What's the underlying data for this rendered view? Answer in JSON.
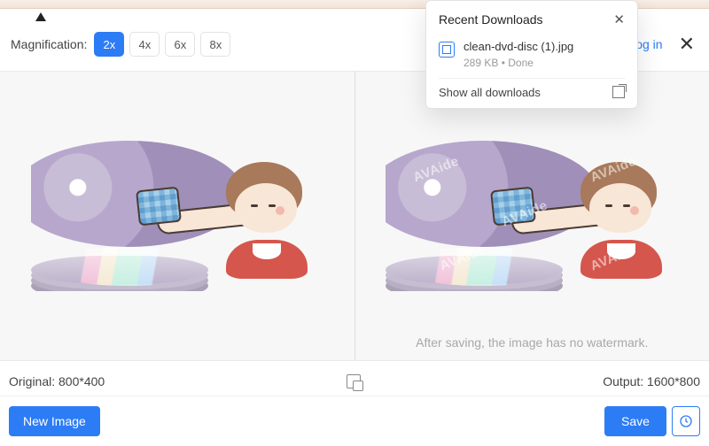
{
  "toolbar": {
    "magnification_label": "Magnification:",
    "options": [
      "2x",
      "4x",
      "6x",
      "8x"
    ],
    "active_index": 0,
    "login_label": "og in"
  },
  "downloads": {
    "title": "Recent Downloads",
    "item_filename": "clean-dvd-disc (1).jpg",
    "item_meta": "289 KB • Done",
    "show_all_label": "Show all downloads"
  },
  "preview": {
    "watermark_text": "AVAide",
    "hint_text": "After saving, the image has no watermark."
  },
  "status": {
    "original_label": "Original: 800*400",
    "output_label": "Output: 1600*800"
  },
  "footer": {
    "new_image_label": "New Image",
    "save_label": "Save"
  }
}
